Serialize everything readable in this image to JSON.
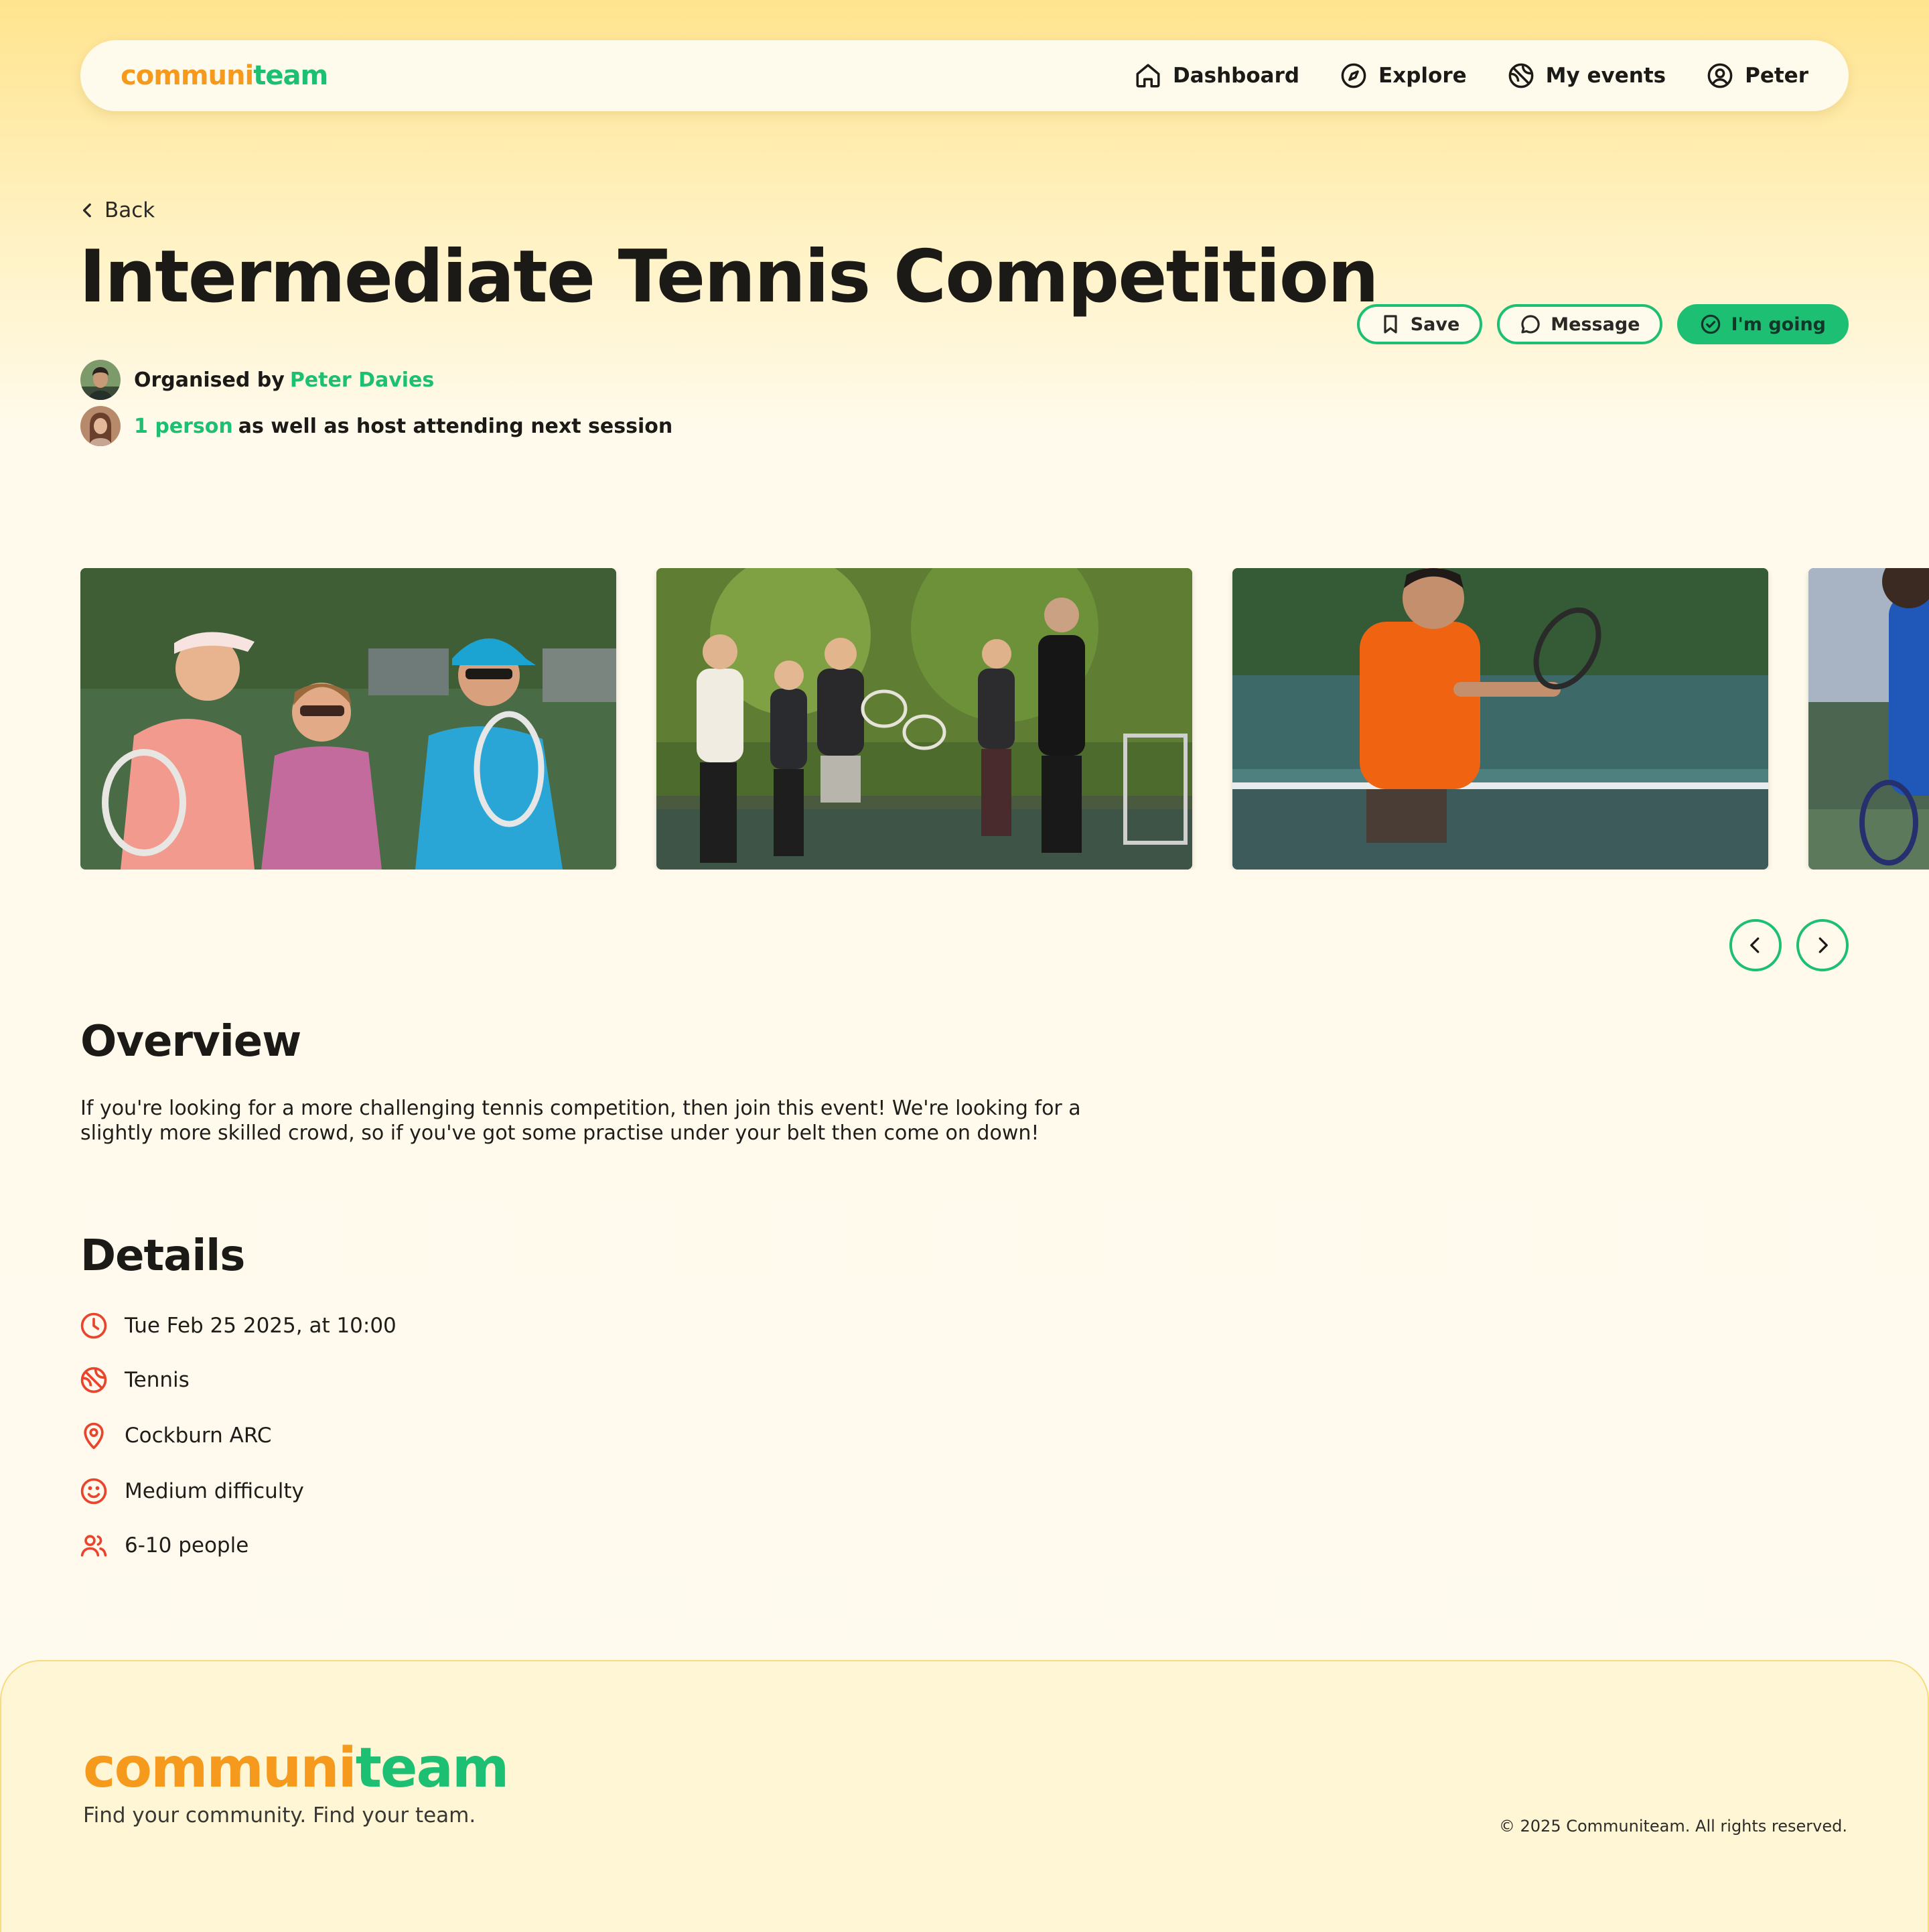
{
  "brand": {
    "part1": "communi",
    "part2": "team"
  },
  "nav": {
    "links": [
      {
        "label": "Dashboard",
        "icon": "home-icon"
      },
      {
        "label": "Explore",
        "icon": "compass-icon"
      },
      {
        "label": "My events",
        "icon": "ball-icon"
      },
      {
        "label": "Peter",
        "icon": "user-circle-icon"
      }
    ]
  },
  "back_label": "Back",
  "event": {
    "title": "Intermediate Tennis Competition",
    "organised_prefix": "Organised by",
    "organiser": "Peter Davies",
    "attendees_link": "1 person",
    "attendees_suffix": "as well as host attending next session"
  },
  "actions": {
    "save": "Save",
    "message": "Message",
    "going": "I'm going"
  },
  "gallery": {
    "photos": [
      "three-women-with-rackets",
      "tennis-group-lesson",
      "player-forehand-orange-shirt",
      "player-blue-shirt-partial"
    ]
  },
  "overview": {
    "heading": "Overview",
    "text": "If you're looking for a more challenging tennis competition, then join this event! We're looking for a slightly more skilled crowd, so if you've got some practise under your belt then come on down!"
  },
  "details": {
    "heading": "Details",
    "items": [
      {
        "icon": "clock-icon",
        "text": "Tue Feb 25 2025, at 10:00"
      },
      {
        "icon": "ball-icon",
        "text": "Tennis"
      },
      {
        "icon": "map-pin-icon",
        "text": "Cockburn ARC"
      },
      {
        "icon": "smile-icon",
        "text": "Medium difficulty"
      },
      {
        "icon": "users-icon",
        "text": "6-10 people"
      }
    ]
  },
  "footer": {
    "tagline": "Find your community. Find your team.",
    "copyright": "© 2025 Communiteam. All rights reserved."
  },
  "colors": {
    "accent_green": "#1dbf73",
    "accent_orange": "#f59a1c",
    "icon_red": "#e8452c",
    "header_yellow": "#ffe48f"
  }
}
